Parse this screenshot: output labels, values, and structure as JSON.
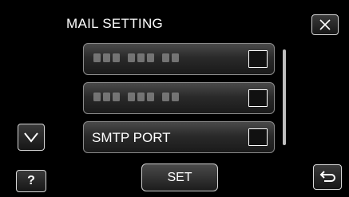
{
  "header": {
    "title": "MAIL SETTING",
    "close_icon": "close-icon"
  },
  "list": {
    "items": [
      {
        "label": "",
        "obscured": true,
        "checked": false
      },
      {
        "label": "",
        "obscured": true,
        "checked": false
      },
      {
        "label": "SMTP PORT",
        "obscured": false,
        "checked": false
      }
    ]
  },
  "footer": {
    "set_label": "SET",
    "help_label": "?",
    "down_icon": "chevron-down-icon",
    "back_icon": "return-arrow-icon"
  },
  "colors": {
    "background": "#000000",
    "text": "#ffffff",
    "button_border": "#d8d8d8"
  }
}
